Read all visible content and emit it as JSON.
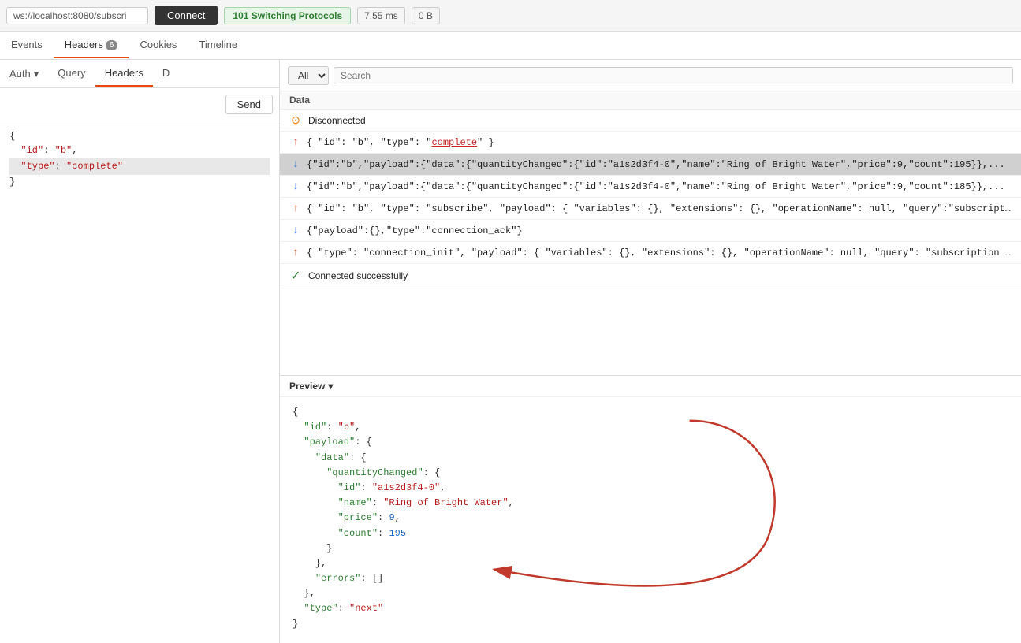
{
  "topbar": {
    "url": "ws://localhost:8080/subscri",
    "connect_label": "Connect",
    "status": "101 Switching Protocols",
    "timing": "7.55 ms",
    "size": "0 B"
  },
  "tabs_top": [
    {
      "id": "events",
      "label": "Events",
      "badge": null
    },
    {
      "id": "headers",
      "label": "Headers",
      "badge": "6"
    },
    {
      "id": "cookies",
      "label": "Cookies",
      "badge": null
    },
    {
      "id": "timeline",
      "label": "Timeline",
      "badge": null
    }
  ],
  "left_tabs": [
    {
      "id": "auth",
      "label": "Auth",
      "dropdown": true
    },
    {
      "id": "query",
      "label": "Query"
    },
    {
      "id": "headers",
      "label": "Headers"
    },
    {
      "id": "d",
      "label": "D"
    }
  ],
  "send_label": "Send",
  "left_code": "{\n  \"id\": \"b\",\n  \"type\": \"complete\"\n}",
  "filter": {
    "all_option": "All",
    "search_placeholder": "Search"
  },
  "data_header": "Data",
  "events": [
    {
      "id": "disconnected",
      "type": "status",
      "icon": "disconnected",
      "text": "Disconnected"
    },
    {
      "id": "msg1",
      "type": "up",
      "icon": "up",
      "text": "{ \"id\": \"b\", \"type\": \"complete\" }",
      "underline": "complete"
    },
    {
      "id": "msg2",
      "type": "down",
      "icon": "down",
      "text": "{\"id\":\"b\",\"payload\":{\"data\":{\"quantityChanged\":{\"id\":\"a1s2d3f4-0\",\"name\":\"Ring of Bright Water\",\"price\":9,\"count\":195}},...",
      "selected": true
    },
    {
      "id": "msg3",
      "type": "down",
      "icon": "down",
      "text": "{\"id\":\"b\",\"payload\":{\"data\":{\"quantityChanged\":{\"id\":\"a1s2d3f4-0\",\"name\":\"Ring of Bright Water\",\"price\":9,\"count\":185}},..."
    },
    {
      "id": "msg4",
      "type": "up",
      "icon": "up",
      "text": "{ \"id\": \"b\", \"type\": \"subscribe\", \"payload\": { \"variables\": {}, \"extensions\": {}, \"operationName\": null, \"query\":\"subscription..."
    },
    {
      "id": "msg5",
      "type": "down",
      "icon": "down",
      "text": "{\"payload\":{},\"type\":\"connection_ack\"}"
    },
    {
      "id": "msg6",
      "type": "up",
      "icon": "up",
      "text": "{ \"type\": \"connection_init\", \"payload\": { \"variables\": {}, \"extensions\": {}, \"operationName\": null, \"query\": \"subscription { ..."
    },
    {
      "id": "connected",
      "type": "status",
      "icon": "connected",
      "text": "Connected successfully"
    }
  ],
  "preview": {
    "label": "Preview",
    "content": "{\n  \"id\": \"b\",\n  \"payload\": {\n    \"data\": {\n      \"quantityChanged\": {\n        \"id\": \"a1s2d3f4-0\",\n        \"name\": \"Ring of Bright Water\",\n        \"price\": 9,\n        \"count\": 195\n      }\n    },\n    \"errors\": []\n  },\n  \"type\": \"next\"\n}"
  }
}
